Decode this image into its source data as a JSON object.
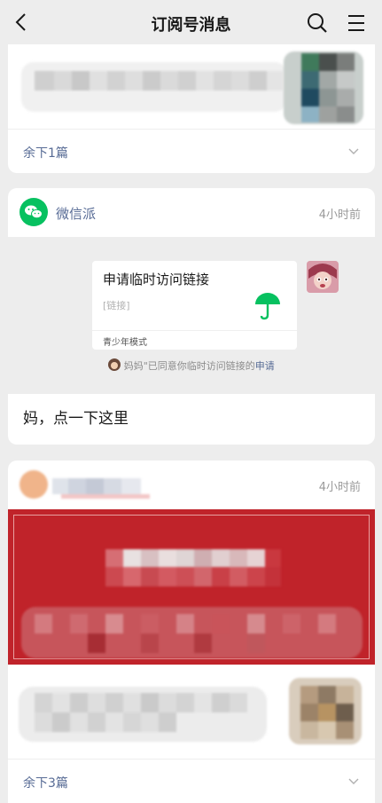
{
  "nav": {
    "title": "订阅号消息"
  },
  "card1": {
    "more_label": "余下1篇"
  },
  "card2": {
    "account_name": "微信派",
    "time": "4小时前",
    "link_title": "申请临时访问链接",
    "link_tag": "[链接]",
    "link_footer": "青少年模式",
    "notice_prefix": "妈妈\"已同意你临时访问链接的",
    "notice_link": "申请",
    "message": "妈，点一下这里"
  },
  "card3": {
    "time": "4小时前",
    "more_label": "余下3篇"
  },
  "colors": {
    "link_blue": "#576b95",
    "wechat_green": "#07c160",
    "banner_red": "#c0232a"
  }
}
